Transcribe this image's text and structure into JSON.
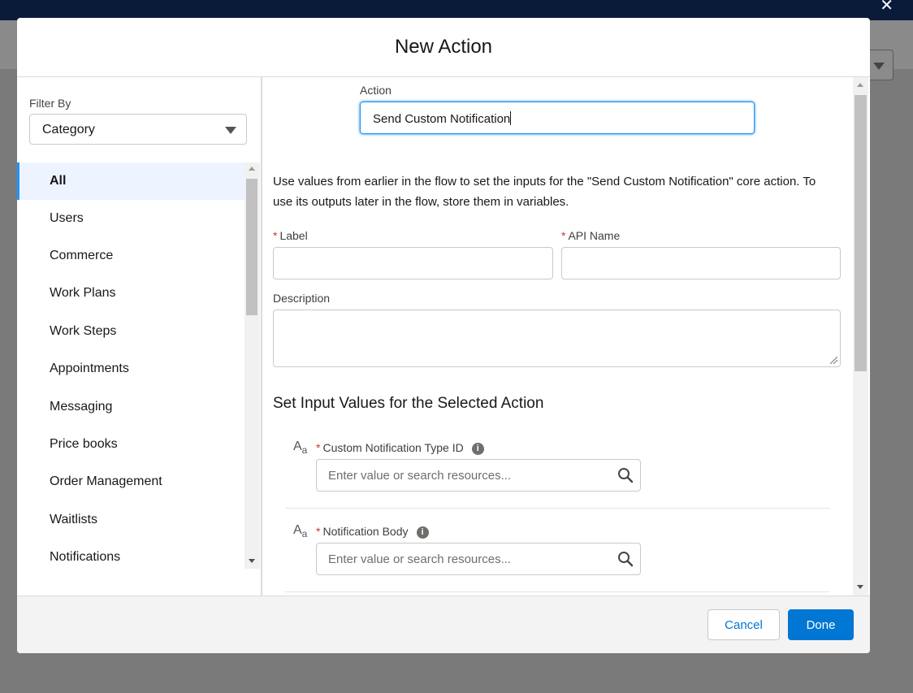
{
  "modal": {
    "title": "New Action"
  },
  "filter": {
    "label": "Filter By",
    "value": "Category"
  },
  "categories": [
    {
      "label": "All",
      "active": true
    },
    {
      "label": "Users"
    },
    {
      "label": "Commerce"
    },
    {
      "label": "Work Plans"
    },
    {
      "label": "Work Steps"
    },
    {
      "label": "Appointments"
    },
    {
      "label": "Messaging"
    },
    {
      "label": "Price books"
    },
    {
      "label": "Order Management"
    },
    {
      "label": "Waitlists"
    },
    {
      "label": "Notifications"
    }
  ],
  "action": {
    "label": "Action",
    "value": "Send Custom Notification"
  },
  "instructions": "Use values from earlier in the flow to set the inputs for the \"Send Custom Notification\" core action. To use its outputs later in the flow, store them in variables.",
  "fields": {
    "label": {
      "label": "Label",
      "required_mark": "*",
      "value": ""
    },
    "api_name": {
      "label": "API Name",
      "required_mark": "*",
      "value": ""
    },
    "description": {
      "label": "Description",
      "value": ""
    }
  },
  "section_title": "Set Input Values for the Selected Action",
  "params": [
    {
      "label": "Custom Notification Type ID",
      "required_mark": "*",
      "placeholder": "Enter value or search resources...",
      "icon": "text-type-icon"
    },
    {
      "label": "Notification Body",
      "required_mark": "*",
      "placeholder": "Enter value or search resources...",
      "icon": "text-type-icon"
    }
  ],
  "footer": {
    "cancel_label": "Cancel",
    "done_label": "Done"
  },
  "colors": {
    "brand": "#0176d3",
    "focus": "#1b96ff",
    "required": "#c23934",
    "header_bar": "#0a1b3a"
  }
}
